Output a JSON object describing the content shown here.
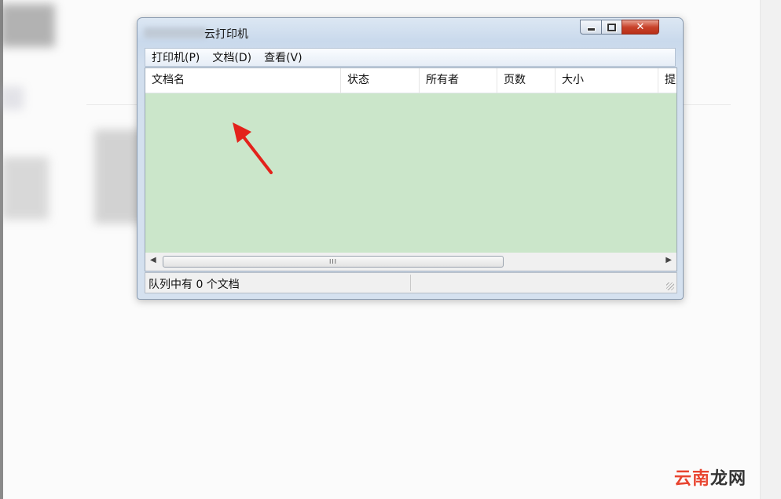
{
  "window": {
    "title": "云打印机",
    "menu": [
      "打印机(P)",
      "文档(D)",
      "查看(V)"
    ]
  },
  "list": {
    "columns": [
      "文档名",
      "状态",
      "所有者",
      "页数",
      "大小",
      "提交"
    ]
  },
  "scrollbar": {
    "thumb_label": "III"
  },
  "status": {
    "text": "队列中有 0 个文档"
  },
  "watermark": {
    "part1": "云南",
    "part2": "龙网"
  },
  "colors": {
    "list_background": "#cbe6ca",
    "annotation_arrow": "#e3221b",
    "close_button": "#c8432b"
  }
}
